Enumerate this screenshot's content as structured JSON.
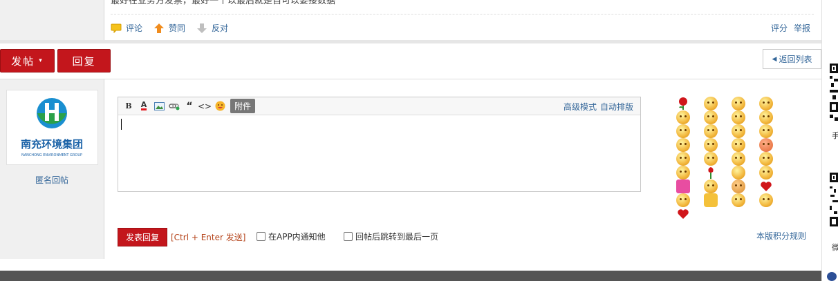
{
  "post": {
    "text": "最好在业务方发票，最好一个以最后就是自可以要接数据",
    "actions": [
      {
        "label": "评论",
        "icon": "comment-icon"
      },
      {
        "label": "赞同",
        "icon": "thumb-up-arrow-icon"
      },
      {
        "label": "反对",
        "icon": "thumb-down-arrow-icon"
      }
    ],
    "rate": "评分",
    "report": "举报"
  },
  "toolbar": {
    "new_post": "发帖",
    "reply": "回复",
    "back_to_list": "返回列表"
  },
  "user": {
    "logo_text": "南充环境集团",
    "logo_subtext": "NANCHONG ENVIRONMENT GROUP",
    "anonymous": "匿名回帖"
  },
  "editor": {
    "tools": [
      "B",
      "A",
      "image",
      "link",
      "quote",
      "code",
      "emoji"
    ],
    "attachment": "附件",
    "advanced_mode": "高级模式",
    "auto_format": "自动排版"
  },
  "submit": {
    "button": "发表回复",
    "hint": "[Ctrl + Enter 发送]",
    "notify_app": "在APP内通知他",
    "jump_last": "回帖后跳转到最后一页",
    "rules": "本版积分规则"
  },
  "sidebar": {
    "label1": "手",
    "label2": "微"
  },
  "colors": {
    "brand_red": "#c3161c",
    "link_blue": "#336699",
    "footer": "#555555"
  }
}
